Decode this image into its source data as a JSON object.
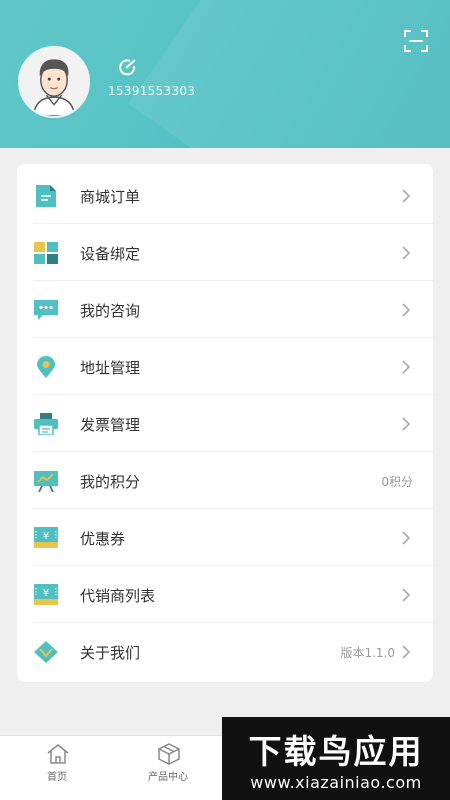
{
  "profile": {
    "phone": "15391553303"
  },
  "menu": [
    {
      "label": "商城订单",
      "icon": "document-icon",
      "right": ""
    },
    {
      "label": "设备绑定",
      "icon": "grid-icon",
      "right": ""
    },
    {
      "label": "我的咨询",
      "icon": "chat-icon",
      "right": ""
    },
    {
      "label": "地址管理",
      "icon": "location-pin-icon",
      "right": ""
    },
    {
      "label": "发票管理",
      "icon": "printer-icon",
      "right": ""
    },
    {
      "label": "我的积分",
      "icon": "chart-board-icon",
      "right": "0积分"
    },
    {
      "label": "优惠券",
      "icon": "coupon-icon",
      "right": ""
    },
    {
      "label": "代销商列表",
      "icon": "coupon-icon",
      "right": ""
    },
    {
      "label": "关于我们",
      "icon": "diamond-heart-icon",
      "right": "版本1.1.0"
    }
  ],
  "tabbar": [
    {
      "label": "首页",
      "icon": "home-icon"
    },
    {
      "label": "产品中心",
      "icon": "box-icon"
    }
  ],
  "watermark": {
    "title": "下载鸟应用",
    "url": "www.xiazainiao.com"
  },
  "colors": {
    "accent": "#4fbfc2",
    "icon_dark": "#2f7f86",
    "icon_yellow": "#e8c44a",
    "text": "#333333",
    "muted": "#999999"
  }
}
